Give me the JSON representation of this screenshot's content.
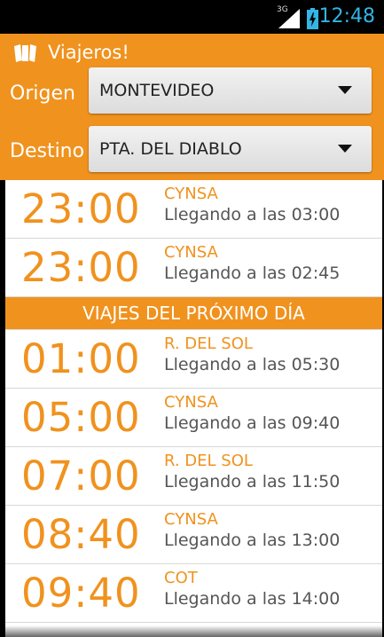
{
  "status_bar": {
    "network": "3G",
    "time": "12:48"
  },
  "app": {
    "title": "Viajeros!"
  },
  "origin": {
    "label": "Origen",
    "value": "MONTEVIDEO"
  },
  "destination": {
    "label": "Destino",
    "value": "PTA. DEL DIABLO"
  },
  "trips_today": [
    {
      "time": "23:00",
      "company": "CYNSA",
      "arrival": "Llegando a las 03:00"
    },
    {
      "time": "23:00",
      "company": "CYNSA",
      "arrival": "Llegando a las 02:45"
    }
  ],
  "next_day_header": "VIAJES DEL PRÓXIMO DÍA",
  "trips_next_day": [
    {
      "time": "01:00",
      "company": "R. DEL SOL",
      "arrival": "Llegando a las 05:30"
    },
    {
      "time": "05:00",
      "company": "CYNSA",
      "arrival": "Llegando a las 09:40"
    },
    {
      "time": "07:00",
      "company": "R. DEL SOL",
      "arrival": "Llegando a las 11:50"
    },
    {
      "time": "08:40",
      "company": "CYNSA",
      "arrival": "Llegando a las 13:00"
    },
    {
      "time": "09:40",
      "company": "COT",
      "arrival": "Llegando a las 14:00"
    }
  ],
  "colors": {
    "accent": "#f0921e",
    "status_time": "#33b5e5"
  }
}
